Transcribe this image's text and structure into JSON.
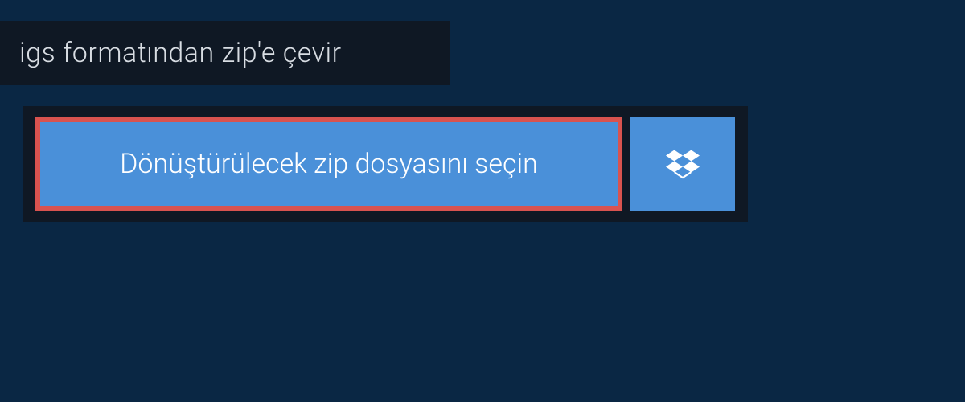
{
  "header": {
    "title": "igs formatından zip'e çevir"
  },
  "actions": {
    "select_file_label": "Dönüştürülecek zip dosyasını seçin",
    "dropbox_icon_name": "dropbox-icon"
  },
  "colors": {
    "page_bg": "#0a2744",
    "panel_bg": "#0f1824",
    "button_bg": "#4a90d9",
    "highlight_border": "#d9534f",
    "text_light": "#d8dde3",
    "text_white": "#ffffff"
  }
}
